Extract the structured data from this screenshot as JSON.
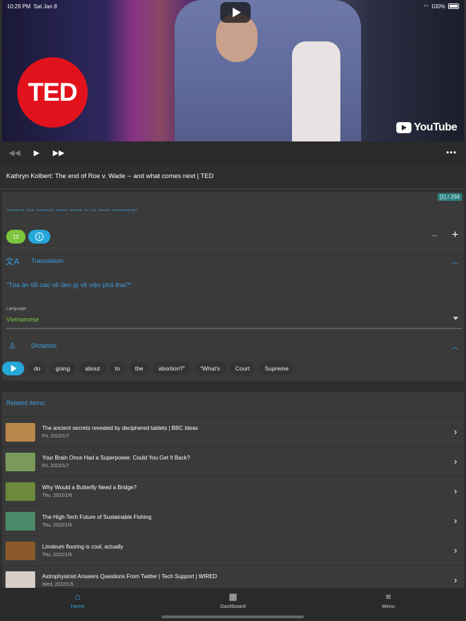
{
  "status": {
    "time": "10:29 PM",
    "date": "Sat Jan 8",
    "battery": "100%"
  },
  "video": {
    "logo_text": "TED",
    "youtube_text": "YouTube"
  },
  "player": {
    "title": "Kathryn Kolbert: The end of Roe v. Wade -- and what comes next | TED"
  },
  "lesson": {
    "counter": "[1] / 294",
    "masked_text": "\"*****'* *** ******* ***** ***** ** ** ***** ********?\"",
    "level": "10",
    "translation": {
      "label": "Translation",
      "text": "\"Tòa án tối cao sẽ làm gì về việc phá thai?\"",
      "language_label": "Language",
      "language_value": "Vietnamese"
    },
    "dictation": {
      "label": "Dictation",
      "words": [
        "do",
        "going",
        "about",
        "to",
        "the",
        "abortion?\"",
        "\"What's",
        "Court",
        "Supreme"
      ]
    }
  },
  "related": {
    "label": "Related items:",
    "items": [
      {
        "title": "The ancient secrets revealed by deciphered tablets | BBC Ideas",
        "date": "Fri, 2022/1/7",
        "thumb": "#b8864a"
      },
      {
        "title": "Your Brain Once Had a Superpower. Could You Get It Back?",
        "date": "Fri, 2022/1/7",
        "thumb": "#7a9a5a"
      },
      {
        "title": "Why Would a Butterfly Need a Bridge?",
        "date": "Thu, 2022/1/6",
        "thumb": "#6b8a3a"
      },
      {
        "title": "The High-Tech Future of Sustainable Fishing",
        "date": "Thu, 2022/1/6",
        "thumb": "#4a8a6a"
      },
      {
        "title": "Linoleum flooring is cool, actually",
        "date": "Thu, 2022/1/6",
        "thumb": "#8a5a2a"
      },
      {
        "title": "Astrophysicist Answers Questions From Twitter | Tech Support | WIRED",
        "date": "Wed, 2022/1/5",
        "thumb": "#d8d0c8"
      }
    ]
  },
  "tabs": [
    {
      "label": "Home",
      "icon": "home-icon",
      "glyph": "⌂"
    },
    {
      "label": "Dashboard",
      "icon": "dashboard-icon",
      "glyph": "▦"
    },
    {
      "label": "Menu",
      "icon": "menu-icon",
      "glyph": "≡"
    }
  ]
}
